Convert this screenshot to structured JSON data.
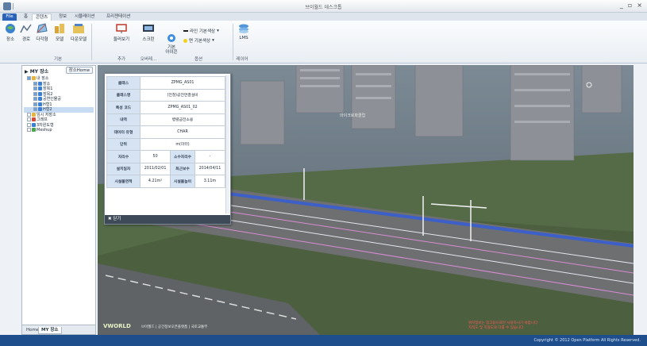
{
  "window": {
    "title": "브이월드 데스크톱",
    "controls": [
      "_",
      "▫",
      "×"
    ]
  },
  "tabs": [
    {
      "label": "File",
      "kind": "file"
    },
    {
      "label": "홈",
      "kind": "normal"
    },
    {
      "label": "콘텐츠",
      "kind": "active"
    },
    {
      "label": "정보",
      "kind": "normal"
    },
    {
      "label": "시뮬레이션",
      "kind": "normal"
    },
    {
      "label": "프리젠테이션",
      "kind": "normal"
    }
  ],
  "ribbon": {
    "buttons": [
      {
        "label": "장소",
        "icon": "globe-pin-icon"
      },
      {
        "label": "경로",
        "icon": "route-icon"
      },
      {
        "label": "다각형",
        "icon": "polygon-icon"
      },
      {
        "label": "모델",
        "icon": "model-icon"
      },
      {
        "label": "다운모델",
        "icon": "download-model-icon"
      },
      {
        "label": "둘러보기",
        "icon": "tour-icon"
      },
      {
        "label": "스크린",
        "icon": "screen-icon"
      },
      {
        "label": "기본\n아이콘",
        "icon": "basic-icon"
      },
      {
        "label": "LMS",
        "icon": "layers-icon"
      }
    ],
    "style_rows": [
      {
        "label": "라인 기본색상",
        "swatch": "#222222"
      },
      {
        "label": "면 기본색상",
        "swatch": "#f2d21b"
      }
    ],
    "groups": [
      "기본",
      "추가",
      "오버레...",
      "옵션",
      "레이어"
    ]
  },
  "left_panel": {
    "title": "MY 장소",
    "home_button": "장소Home",
    "tree": [
      {
        "label": "내 장소",
        "depth": 0,
        "checked": true,
        "color": "#e6b43a",
        "selected": false
      },
      {
        "label": "장소",
        "depth": 1,
        "checked": true,
        "color": "#3a7fd6",
        "selected": false
      },
      {
        "label": "장목1",
        "depth": 1,
        "checked": true,
        "color": "#3a7fd6",
        "selected": false
      },
      {
        "label": "장목2",
        "depth": 1,
        "checked": true,
        "color": "#3a7fd6",
        "selected": false
      },
      {
        "label": "공연인물공",
        "depth": 1,
        "checked": true,
        "color": "#3a7fd6",
        "selected": false
      },
      {
        "label": "H형1",
        "depth": 1,
        "checked": true,
        "color": "#3a7fd6",
        "selected": false
      },
      {
        "label": "H형2",
        "depth": 1,
        "checked": true,
        "color": "#3a7fd6",
        "selected": true
      },
      {
        "label": "임시 저장소",
        "depth": 0,
        "checked": false,
        "color": "#e6b43a",
        "selected": false
      },
      {
        "label": "그래프",
        "depth": 0,
        "checked": false,
        "color": "#d64b3a",
        "selected": false
      },
      {
        "label": "3차원도형",
        "depth": 0,
        "checked": false,
        "color": "#3a7fd6",
        "selected": false
      },
      {
        "label": "Meshup",
        "depth": 0,
        "checked": false,
        "color": "#4aa64a",
        "selected": false
      }
    ],
    "bottom_tabs": [
      {
        "label": "Home",
        "active": false
      },
      {
        "label": "MY 장소",
        "active": true
      }
    ]
  },
  "popup": {
    "rows": [
      {
        "key": "클래스",
        "value": "ZPMG_AS01"
      },
      {
        "key": "클래스명",
        "value": "(전철)공전연결설비"
      },
      {
        "key": "특성 코드",
        "value": "ZPMG_AS01_02"
      },
      {
        "key": "내역",
        "value": "병렬급전소용"
      },
      {
        "key": "데이터 유형",
        "value": "CHAR"
      },
      {
        "key": "단위",
        "value": "m(미터)"
      }
    ],
    "pair_rows": [
      {
        "k1": "자리수",
        "v1": "50",
        "k2": "소수자리수",
        "v2": "-"
      },
      {
        "k1": "설치일자",
        "v1": "2011/02/01",
        "k2": "최근보수",
        "v2": "2014/04/11"
      },
      {
        "k1": "시설물면적",
        "v1": "4.21m²",
        "k2": "시설물높이",
        "v2": "3.11m"
      }
    ],
    "close_label": "✖ 닫기"
  },
  "map_overlay": {
    "logo": "VWORLD",
    "credit": "브이월드 | 공간정보오픈플랫폼 | 국토교통부",
    "warning_lines": [
      "위치정보는 참고용으로만 사용하시기 바랍니다",
      "지적도 및 지형도와 다를 수 있습니다"
    ]
  },
  "status": {
    "copyright": "Copyright © 2012 Open Platform All Rights Reserved."
  }
}
